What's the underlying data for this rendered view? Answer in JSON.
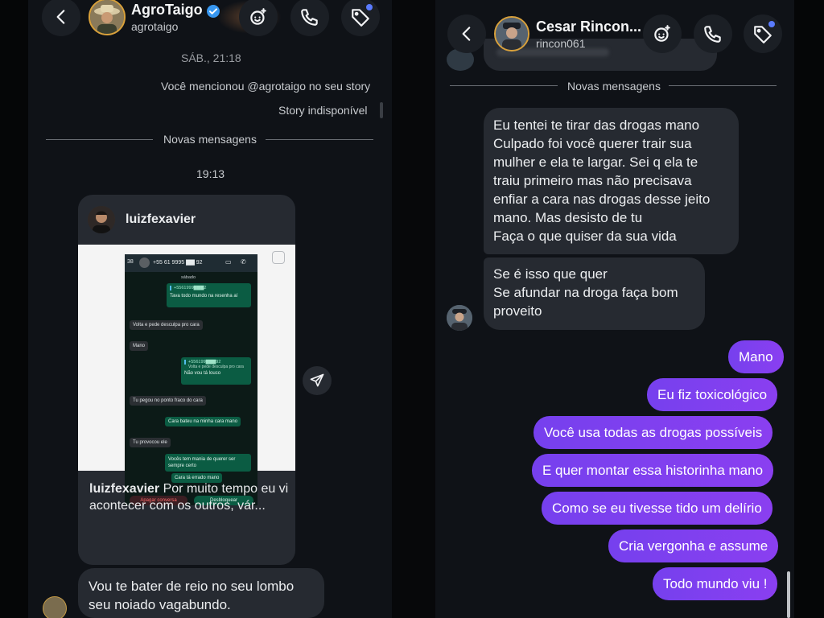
{
  "left_chat": {
    "contact_name": "AgroTaigo",
    "contact_handle": "agrotaigo",
    "verified": true,
    "date_stamp": "SÁB., 21:18",
    "mention_note": "Você mencionou @agrotaigo no seu story",
    "story_unavailable": "Story indisponível",
    "new_messages_label": "Novas mensagens",
    "time_stamp": "19:13",
    "shared_post": {
      "author": "luizfexavier",
      "caption_author": "luizfexavier",
      "caption_text": "Por muito tempo eu vi acontecer com os outros, vár...",
      "whatsapp_screenshot": {
        "back_count": "38",
        "phone_number": "+55 61 9995 ▇▇ 92",
        "day_label": "sábado",
        "messages": [
          {
            "dir": "out",
            "text": "Tava todo mundo na resenha aí",
            "quote": "+5561999▇▇▇2",
            "time": "23:42"
          },
          {
            "dir": "in",
            "text": "Volta e pede desculpa pro cara",
            "time": "23:42"
          },
          {
            "dir": "in",
            "text": "Mano",
            "time": "23:42"
          },
          {
            "dir": "out",
            "text": "Não vou tá louco",
            "quote": "+556199▇▇▇92",
            "quote_sub": "Volta e pede desculpa pro cara",
            "time": "23:42"
          },
          {
            "dir": "in",
            "text": "Tu pegou no ponto fraco do cara",
            "time": "23:43"
          },
          {
            "dir": "out",
            "text": "Cara bateu na minha cara mano",
            "time": "23:43"
          },
          {
            "dir": "in",
            "text": "Tu provocou ele",
            "time": "23:43"
          },
          {
            "dir": "out",
            "text": "Vocês tem mania de querer ser sempre certo",
            "time": "23:43"
          },
          {
            "dir": "out",
            "text": "Cara tá errado mano",
            "time": "23:43"
          }
        ],
        "clear_button": "Apagar conversa",
        "unblock_button": "Desbloquear"
      }
    },
    "incoming_last": "Vou te bater de reio no seu lombo seu noiado vagabundo."
  },
  "right_chat": {
    "contact_name": "Cesar Rincon...",
    "contact_handle": "rincon061",
    "new_messages_label": "Novas mensagens",
    "incoming": [
      {
        "lines": [
          "Eu tentei te tirar das drogas mano",
          "Culpado foi você querer trair sua",
          "mulher e ela te largar. Sei q ela te",
          "traiu primeiro mas não precisava",
          "enfiar a cara nas drogas desse jeito",
          "mano. Mas desisto de tu",
          "Faça o que quiser da sua vida"
        ]
      },
      {
        "lines": [
          "Se é isso que quer",
          "Se afundar na droga faça bom",
          "proveito"
        ]
      }
    ],
    "outgoing": [
      "Mano",
      "Eu fiz toxicológico",
      "Você usa todas as drogas possíveis",
      "E quer montar essa historinha mano",
      "Como se eu tivesse tido um delírio",
      "Cria vergonha e assume",
      "Todo mundo viu !"
    ]
  },
  "icons": [
    "back-icon",
    "effects-icon",
    "phone-icon",
    "tag-icon",
    "share-icon",
    "verified-badge-icon"
  ],
  "colors": {
    "outgoing_bubble": "#7c3aed",
    "incoming_bubble": "#262a31",
    "background": "#0f1217",
    "verified": "#3797f0",
    "notification_dot": "#5a7bff"
  }
}
